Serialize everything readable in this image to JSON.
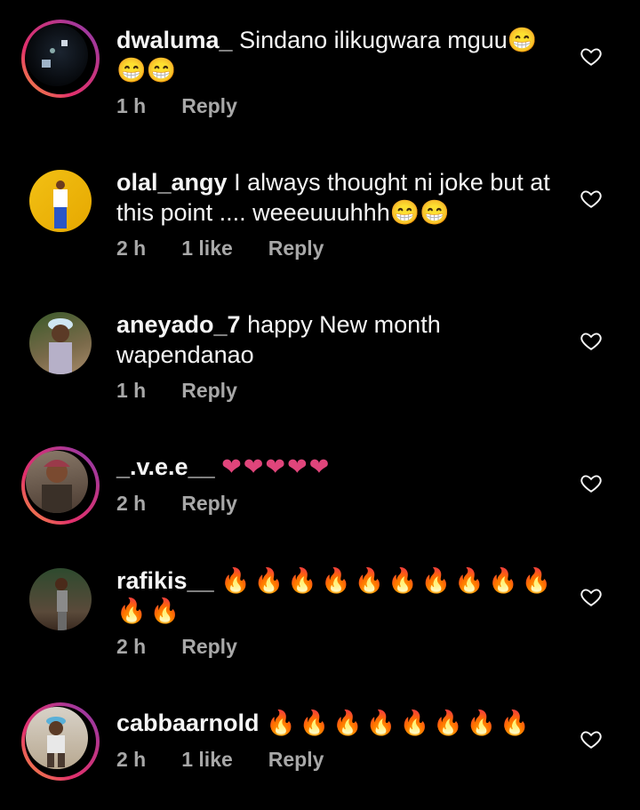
{
  "comments": [
    {
      "username": "dwaluma_",
      "text": "Sindano ilikugwara mguu😁😁😁",
      "time": "1 h",
      "likes": "",
      "reply": "Reply"
    },
    {
      "username": "olal_angy",
      "text": "I always thought ni joke but at this point .... weeeuuuhhh😁😁",
      "time": "2 h",
      "likes": "1 like",
      "reply": "Reply"
    },
    {
      "username": "aneyado_7",
      "text": "happy New month wapendanao",
      "time": "1 h",
      "likes": "",
      "reply": "Reply"
    },
    {
      "username": "_.v.e.e__",
      "text": "❤❤❤❤❤",
      "time": "2 h",
      "likes": "",
      "reply": "Reply"
    },
    {
      "username": "rafikis__",
      "text": "🔥🔥🔥🔥🔥🔥🔥🔥🔥🔥🔥🔥",
      "time": "2 h",
      "likes": "",
      "reply": "Reply"
    },
    {
      "username": "cabbaarnold",
      "text": "🔥🔥🔥🔥🔥🔥🔥🔥",
      "time": "2 h",
      "likes": "1 like",
      "reply": "Reply"
    }
  ],
  "colors": {
    "heart_stroke": "#f5f5f5",
    "story_ring": "#e1306c",
    "meta": "#a8a8a8",
    "emoji_heart": "#e0457b"
  }
}
